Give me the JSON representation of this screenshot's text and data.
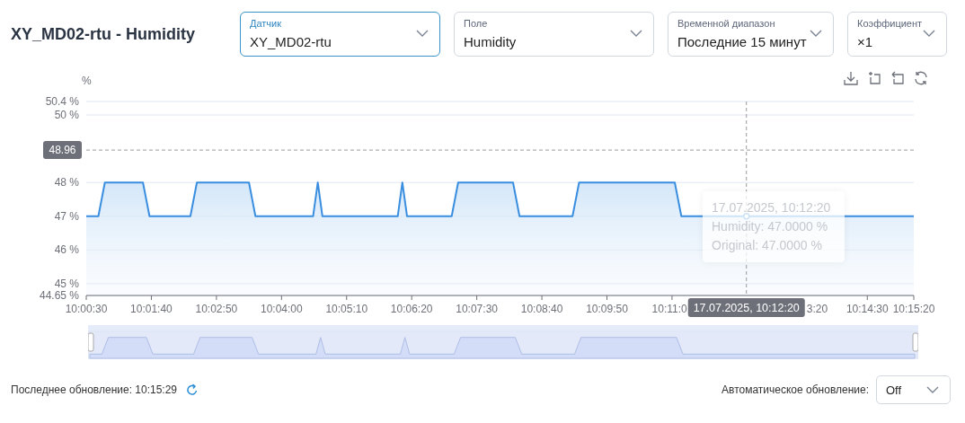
{
  "title": "XY_MD02-rtu - Humidity",
  "selectors": [
    {
      "label": "Датчик",
      "value": "XY_MD02-rtu",
      "focused": true
    },
    {
      "label": "Поле",
      "value": "Humidity",
      "focused": false
    },
    {
      "label": "Временной диапазон",
      "value": "Последние 15 минут",
      "focused": false
    },
    {
      "label": "Коэффициент",
      "value": "×1",
      "focused": false
    }
  ],
  "chart_data": {
    "type": "line",
    "ylabel": "%",
    "x": [
      36030,
      36043,
      36050,
      36091,
      36098,
      36142,
      36149,
      36205,
      36212,
      36274,
      36279,
      36284,
      36365,
      36370,
      36375,
      36423,
      36430,
      36489,
      36496,
      36553,
      36560,
      36663,
      36670,
      36920
    ],
    "series": [
      {
        "color": "#3a8ee0",
        "values": [
          47,
          47,
          48,
          48,
          47,
          47,
          48,
          48,
          47,
          47,
          48,
          47,
          47,
          48,
          47,
          47,
          48,
          48,
          47,
          47,
          48,
          48,
          47,
          47
        ]
      }
    ],
    "xlim": [
      36030,
      36920
    ],
    "ylim": [
      44.65,
      50.4
    ],
    "grid": true,
    "xticks": [
      {
        "value": 36030,
        "label": "10:00:30"
      },
      {
        "value": 36100,
        "label": "10:01:40"
      },
      {
        "value": 36170,
        "label": "10:02:50"
      },
      {
        "value": 36240,
        "label": "10:04:00"
      },
      {
        "value": 36310,
        "label": "10:05:10"
      },
      {
        "value": 36380,
        "label": "10:06:20"
      },
      {
        "value": 36450,
        "label": "10:07:30"
      },
      {
        "value": 36520,
        "label": "10:08:40"
      },
      {
        "value": 36590,
        "label": "10:09:50"
      },
      {
        "value": 36660,
        "label": "10:11:0"
      },
      {
        "value": 36870,
        "label": "10:14:30"
      },
      {
        "value": 36920,
        "label": "10:15:20"
      }
    ],
    "yticks": [
      {
        "value": 44.65,
        "label": "44.65 %"
      },
      {
        "value": 45,
        "label": "45 %"
      },
      {
        "value": 46,
        "label": "46 %"
      },
      {
        "value": 47,
        "label": "47 %"
      },
      {
        "value": 48,
        "label": "48 %"
      },
      {
        "value": 50,
        "label": "50 %"
      },
      {
        "value": 50.4,
        "label": "50.4 %"
      }
    ],
    "ref_lines": [
      {
        "axis": "y",
        "value": 48.96,
        "label": "48.96"
      },
      {
        "axis": "x",
        "value": 36740
      }
    ]
  },
  "pointer_label": "17.07.2025, 10:12:20",
  "x_label_fragment": "3:20",
  "range_slider": {
    "level": 1
  },
  "tooltip": {
    "title": "17.07.2025, 10:12:20",
    "lines": [
      "Humidity: 47.0000 %",
      "Original: 47.0000 %"
    ]
  },
  "last_update": "Последнее обновление: 10:15:29",
  "auto_update": {
    "label": "Автоматическое обновление:",
    "value": "Off"
  }
}
